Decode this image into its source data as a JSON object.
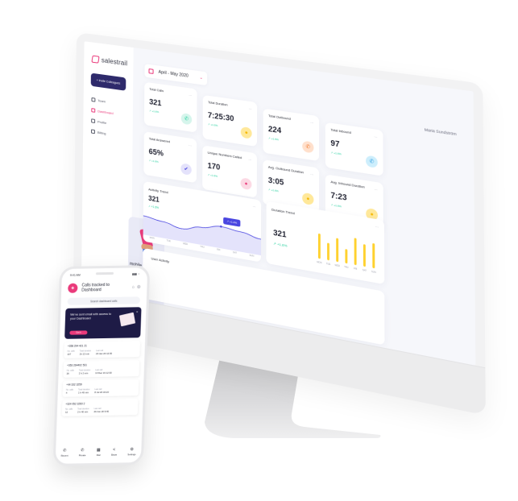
{
  "app": {
    "brand": "salestrail",
    "brand_color": "#ea3a7b",
    "accent_color": "#2e2a6b"
  },
  "sidebar": {
    "invite_label": "+ Invite Colleagues",
    "items": [
      {
        "label": "Team",
        "icon": "team-icon",
        "active": false
      },
      {
        "label": "Dashboard",
        "icon": "dashboard-icon",
        "active": true
      },
      {
        "label": "Profile",
        "icon": "profile-icon",
        "active": false
      },
      {
        "label": "Billing",
        "icon": "billing-icon",
        "active": false
      }
    ],
    "promo_text": "mobile app"
  },
  "header": {
    "date_range": "April - May 2020",
    "user_name": "Maria Sundström"
  },
  "stats": [
    {
      "title": "Total Calls",
      "value": "321",
      "delta": "↗ +1.6%",
      "icon": "phone-icon",
      "icon_bg": "#d6f5ec",
      "icon_color": "#1fcf9c",
      "glyph": "✆"
    },
    {
      "title": "Total Duration",
      "value": "7:25:30",
      "delta": "↗ +1.6%",
      "icon": "clock-icon",
      "icon_bg": "#ffe89a",
      "icon_color": "#f5b800",
      "glyph": "●"
    },
    {
      "title": "Total Outbound",
      "value": "224",
      "delta": "↗ +1.6%",
      "icon": "outbound-call-icon",
      "icon_bg": "#ffe0cc",
      "icon_color": "#f07a2f",
      "glyph": "✆"
    },
    {
      "title": "Total Inbound",
      "value": "97",
      "delta": "↗ +1.6%",
      "icon": "inbound-call-icon",
      "icon_bg": "#cdeefc",
      "icon_color": "#2a9de0",
      "glyph": "✆"
    },
    {
      "title": "Total Answered",
      "value": "65%",
      "delta": "↗ +1.6%",
      "icon": "check-icon",
      "icon_bg": "#e4e2fb",
      "icon_color": "#4a46e0",
      "glyph": "✔"
    },
    {
      "title": "Unique Numbers Called",
      "value": "170",
      "delta": "↗ +1.6%",
      "icon": "unique-icon",
      "icon_bg": "#fcd9e4",
      "icon_color": "#ea3a7b",
      "glyph": "●"
    },
    {
      "title": "Avg. Outbound Duration",
      "value": "3:05",
      "delta": "↗ +1.6%",
      "icon": "timer-icon",
      "icon_bg": "#ffe89a",
      "icon_color": "#f5b800",
      "glyph": "●"
    },
    {
      "title": "Avg. Inbound Duration",
      "value": "7:23",
      "delta": "↗ +1.6%",
      "icon": "timer-icon",
      "icon_bg": "#ffe89a",
      "icon_color": "#f5b800",
      "glyph": "●"
    }
  ],
  "activity_trend": {
    "title": "Activity Trend",
    "value": "321",
    "delta": "↗ +1.6%",
    "tooltip": "↗ +1.2%",
    "days": [
      "MON",
      "TUE",
      "WED",
      "THU",
      "FRI",
      "SAT",
      "SUN"
    ],
    "values": [
      60,
      52,
      40,
      55,
      68,
      62,
      50
    ],
    "line_color": "#4a46e0"
  },
  "duration_trend": {
    "title": "Duration Trend",
    "value": "321",
    "delta": "↗ +1.6%",
    "days": [
      "MON",
      "TUE",
      "WED",
      "THU",
      "FRI",
      "SAT",
      "SUN"
    ],
    "values": [
      80,
      55,
      75,
      45,
      85,
      70,
      78
    ],
    "bar_color": "#ffd12e"
  },
  "user_activity": {
    "title": "User Activity"
  },
  "phone": {
    "time": "9:41 AM",
    "signal": "▮▮▮ ◔",
    "title": "Calls tracked to Dashboard",
    "search": "Search dashboard calls",
    "banner_text": "We've sent email with access to your Dashboard",
    "banner_button": "Got it",
    "calls": [
      {
        "number": "+358 294 421 21",
        "a_label": "No. calls",
        "a": "107",
        "b_label": "Total duration",
        "b": "1h 12 min",
        "c_label": "Last call",
        "c": "20 Jan 20  12:30"
      },
      {
        "number": "+353 264402 531",
        "a_label": "No. calls",
        "a": "26",
        "b_label": "Total duration",
        "b": "2 h 2 min",
        "c_label": "Last call",
        "c": "13 Dec 19  12:30"
      },
      {
        "number": "+44 332 3259",
        "a_label": "No. calls",
        "a": "4",
        "b_label": "Total duration",
        "b": "1 h 40 min",
        "c_label": "Last call",
        "c": "8 Jul 20  16:20"
      },
      {
        "number": "+324 052 3260 2",
        "a_label": "No. calls",
        "a": "12",
        "b_label": "Total duration",
        "b": "2 h 40 min",
        "c_label": "Last call",
        "c": "29 Jun 20  9:40"
      }
    ],
    "tabs": [
      {
        "label": "Recent",
        "glyph": "✆"
      },
      {
        "label": "Private",
        "glyph": "✆"
      },
      {
        "label": "Dial",
        "glyph": "▦"
      },
      {
        "label": "Share",
        "glyph": "<"
      },
      {
        "label": "Settings",
        "glyph": "⚙"
      }
    ]
  }
}
